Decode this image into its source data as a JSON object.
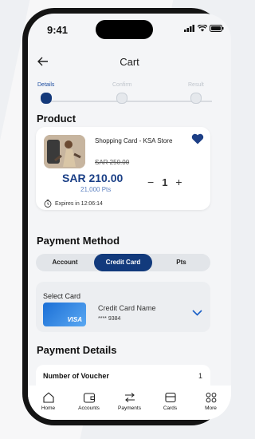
{
  "status": {
    "time": "9:41"
  },
  "nav": {
    "title": "Cart"
  },
  "steps": [
    {
      "label": "Details",
      "active": true
    },
    {
      "label": "Confirm",
      "active": false
    },
    {
      "label": "Result",
      "active": false
    }
  ],
  "sections": {
    "product": "Product",
    "payment_method": "Payment Method",
    "payment_details": "Payment Details"
  },
  "product": {
    "name": "Shopping Card - KSA Store",
    "old_price": "SAR 250.00",
    "price": "SAR 210.00",
    "points": "21,000 Pts",
    "expires": "Expires in 12:06:14",
    "quantity": "1",
    "minus": "−",
    "plus": "+"
  },
  "payment_tabs": [
    {
      "label": "Account",
      "selected": false
    },
    {
      "label": "Credit Card",
      "selected": true
    },
    {
      "label": "Pts",
      "selected": false
    }
  ],
  "select_card": {
    "label": "Select Card",
    "card_name": "Credit Card Name",
    "card_number": "**** 9384",
    "brand": "VISA"
  },
  "details": {
    "voucher_label": "Number of Voucher",
    "voucher_value": "1"
  },
  "tabbar": [
    {
      "label": "Home",
      "icon": "home-icon"
    },
    {
      "label": "Accounts",
      "icon": "wallet-icon"
    },
    {
      "label": "Payments",
      "icon": "transfer-icon"
    },
    {
      "label": "Cards",
      "icon": "card-icon"
    },
    {
      "label": "More",
      "icon": "grid-icon"
    }
  ],
  "colors": {
    "primary": "#123a7c",
    "accent": "#1a3f86",
    "heart": "#1d3f86"
  }
}
